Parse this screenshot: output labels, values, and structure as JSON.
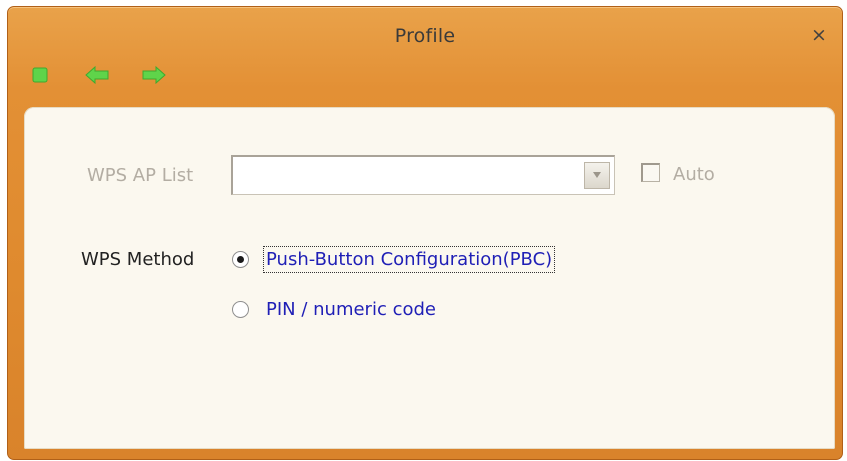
{
  "window": {
    "title": "Profile",
    "close_glyph": "×"
  },
  "toolbar": {
    "buttons": [
      {
        "icon": "stop-icon",
        "color": "#5fd44a"
      },
      {
        "icon": "back-arrow-icon",
        "color": "#5fd44a"
      },
      {
        "icon": "forward-arrow-icon",
        "color": "#5fd44a"
      }
    ]
  },
  "form": {
    "wps_ap_list": {
      "label": "WPS AP List",
      "value": "",
      "enabled": false
    },
    "auto": {
      "label": "Auto",
      "checked": false,
      "enabled": false
    },
    "wps_method": {
      "label": "WPS Method",
      "options": [
        {
          "label": "Push-Button Configuration(PBC)",
          "selected": true
        },
        {
          "label": "PIN / numeric code",
          "selected": false
        }
      ]
    }
  },
  "colors": {
    "title_bar": "#df8a2e",
    "panel_bg": "#fbf8ef",
    "option_text": "#1f1fb6",
    "disabled_text": "#b3ada3"
  }
}
